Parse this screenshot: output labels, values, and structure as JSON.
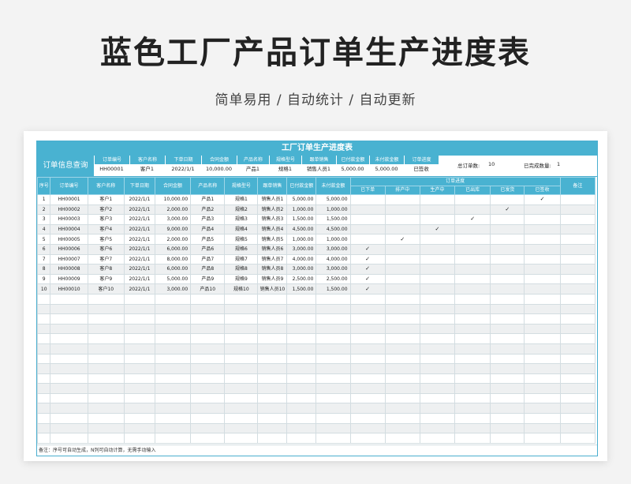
{
  "page": {
    "title": "蓝色工厂产品订单生产进度表",
    "subtitle": "简单易用 / 自动统计 / 自动更新"
  },
  "sheet": {
    "title": "工厂订单生产进度表",
    "query_label": "订单信息查询",
    "query_headers": [
      "订单编号",
      "客户名称",
      "下单日期",
      "合同金额",
      "产品名称",
      "规格型号",
      "跟单销售",
      "已付款金额",
      "未付款金额",
      "订单进度"
    ],
    "query_values": [
      "HH00001",
      "客户1",
      "2022/1/1",
      "10,000.00",
      "产品1",
      "规格1",
      "销售人员1",
      "5,000.00",
      "5,000.00",
      "已签收"
    ],
    "total_label": "总订单数:",
    "total_value": "10",
    "done_label": "已完成数量:",
    "done_value": "1",
    "headers": [
      "序号",
      "订单编号",
      "客户名称",
      "下单日期",
      "合同金额",
      "产品名称",
      "规格型号",
      "跟单销售",
      "已付款金额",
      "未付款金额"
    ],
    "progress_header": "订单进度",
    "progress_stages": [
      "已下单",
      "排产中",
      "生产中",
      "已出库",
      "已发货",
      "已签收"
    ],
    "remark_header": "备注",
    "rows": [
      {
        "no": "1",
        "id": "HH00001",
        "client": "客户1",
        "date": "2022/1/1",
        "amount": "10,000.00",
        "product": "产品1",
        "spec": "规格1",
        "sales": "销售人员1",
        "paid": "5,000.00",
        "unpaid": "5,000.00",
        "stage": 5
      },
      {
        "no": "2",
        "id": "HH00002",
        "client": "客户2",
        "date": "2022/1/1",
        "amount": "2,000.00",
        "product": "产品2",
        "spec": "规格2",
        "sales": "销售人员2",
        "paid": "1,000.00",
        "unpaid": "1,000.00",
        "stage": 4
      },
      {
        "no": "3",
        "id": "HH00003",
        "client": "客户3",
        "date": "2022/1/1",
        "amount": "3,000.00",
        "product": "产品3",
        "spec": "规格3",
        "sales": "销售人员3",
        "paid": "1,500.00",
        "unpaid": "1,500.00",
        "stage": 3
      },
      {
        "no": "4",
        "id": "HH00004",
        "client": "客户4",
        "date": "2022/1/1",
        "amount": "9,000.00",
        "product": "产品4",
        "spec": "规格4",
        "sales": "销售人员4",
        "paid": "4,500.00",
        "unpaid": "4,500.00",
        "stage": 2
      },
      {
        "no": "5",
        "id": "HH00005",
        "client": "客户5",
        "date": "2022/1/1",
        "amount": "2,000.00",
        "product": "产品5",
        "spec": "规格5",
        "sales": "销售人员5",
        "paid": "1,000.00",
        "unpaid": "1,000.00",
        "stage": 1
      },
      {
        "no": "6",
        "id": "HH00006",
        "client": "客户6",
        "date": "2022/1/1",
        "amount": "6,000.00",
        "product": "产品6",
        "spec": "规格6",
        "sales": "销售人员6",
        "paid": "3,000.00",
        "unpaid": "3,000.00",
        "stage": 0
      },
      {
        "no": "7",
        "id": "HH00007",
        "client": "客户7",
        "date": "2022/1/1",
        "amount": "8,000.00",
        "product": "产品7",
        "spec": "规格7",
        "sales": "销售人员7",
        "paid": "4,000.00",
        "unpaid": "4,000.00",
        "stage": 0
      },
      {
        "no": "8",
        "id": "HH00008",
        "client": "客户8",
        "date": "2022/1/1",
        "amount": "6,000.00",
        "product": "产品8",
        "spec": "规格8",
        "sales": "销售人员8",
        "paid": "3,000.00",
        "unpaid": "3,000.00",
        "stage": 0
      },
      {
        "no": "9",
        "id": "HH00009",
        "client": "客户9",
        "date": "2022/1/1",
        "amount": "5,000.00",
        "product": "产品9",
        "spec": "规格9",
        "sales": "销售人员9",
        "paid": "2,500.00",
        "unpaid": "2,500.00",
        "stage": 0
      },
      {
        "no": "10",
        "id": "HH00010",
        "client": "客户10",
        "date": "2022/1/1",
        "amount": "3,000.00",
        "product": "产品10",
        "spec": "规格10",
        "sales": "销售人员10",
        "paid": "1,500.00",
        "unpaid": "1,500.00",
        "stage": 0
      }
    ],
    "check_mark": "✓",
    "note": "备注：序号可自动生成，N列可自动计算，无需手动输入"
  }
}
